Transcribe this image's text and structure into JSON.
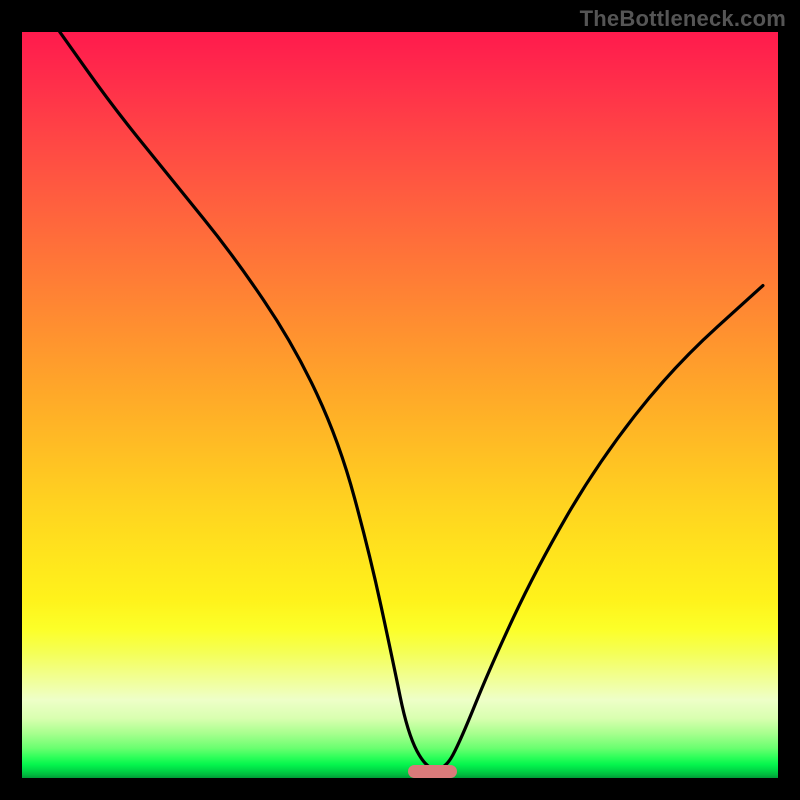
{
  "watermark": "TheBottleneck.com",
  "chart_data": {
    "type": "line",
    "title": "",
    "xlabel": "",
    "ylabel": "",
    "xlim": [
      0,
      100
    ],
    "ylim": [
      0,
      100
    ],
    "grid": false,
    "legend": false,
    "series": [
      {
        "name": "curve",
        "x": [
          5,
          12,
          20,
          28,
          36,
          42,
          46,
          49,
          51,
          53.5,
          56,
          58,
          62,
          68,
          76,
          86,
          98
        ],
        "y": [
          100,
          90,
          80,
          70,
          58,
          45,
          30,
          16,
          6,
          1.2,
          1.2,
          5,
          15,
          28,
          42,
          55,
          66
        ]
      }
    ],
    "optimum_marker": {
      "x_start": 51,
      "x_end": 57.5,
      "y": 0.9
    },
    "gradient_meaning": "top=high bottleneck, bottom=optimal",
    "colors": {
      "curve": "#000000",
      "marker": "#d97a7a",
      "top": "#ff1a4d",
      "mid": "#ffd220",
      "bottom": "#009a36"
    }
  }
}
